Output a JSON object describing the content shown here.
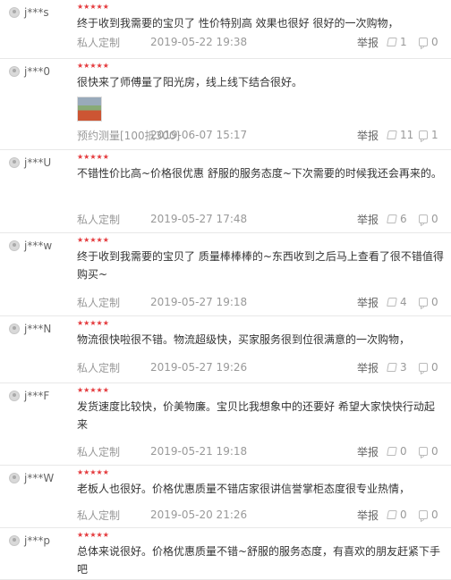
{
  "reviews": [
    {
      "user": "j***s",
      "stars": "★★★★★",
      "text": "终于收到我需要的宝贝了 性价特别高 效果也很好 很好的一次购物，",
      "has_image": false,
      "tag": "私人定制",
      "date": "2019-05-22 19:38",
      "report": "举报",
      "likes": "1",
      "replies": "0"
    },
    {
      "user": "j***0",
      "stars": "★★★★★",
      "text": "很快来了师傅量了阳光房，线上线下结合很好。",
      "has_image": true,
      "tag": "预约测量[100抵300]",
      "date": "2019-06-07 15:17",
      "report": "举报",
      "likes": "11",
      "replies": "1"
    },
    {
      "user": "j***U",
      "stars": "★★★★★",
      "text": "不错性价比高~价格很优惠 舒服的服务态度~下次需要的时候我还会再来的。",
      "has_image": false,
      "tag": "私人定制",
      "date": "2019-05-27 17:48",
      "report": "举报",
      "likes": "6",
      "replies": "0"
    },
    {
      "user": "j***w",
      "stars": "★★★★★",
      "text": "终于收到我需要的宝贝了 质量棒棒棒的~东西收到之后马上查看了很不错值得购买~",
      "has_image": false,
      "tag": "私人定制",
      "date": "2019-05-27 19:18",
      "report": "举报",
      "likes": "4",
      "replies": "0"
    },
    {
      "user": "j***N",
      "stars": "★★★★★",
      "text": "物流很快啦很不错。物流超级快，买家服务很到位很满意的一次购物，",
      "has_image": false,
      "tag": "私人定制",
      "date": "2019-05-27 19:26",
      "report": "举报",
      "likes": "3",
      "replies": "0"
    },
    {
      "user": "j***F",
      "stars": "★★★★★",
      "text": "发货速度比较快，价美物廉。宝贝比我想象中的还要好 希望大家快快行动起来",
      "has_image": false,
      "tag": "私人定制",
      "date": "2019-05-21 19:18",
      "report": "举报",
      "likes": "0",
      "replies": "0"
    },
    {
      "user": "j***W",
      "stars": "★★★★★",
      "text": "老板人也很好。价格优惠质量不错店家很讲信誉掌柜态度很专业热情，",
      "has_image": false,
      "tag": "私人定制",
      "date": "2019-05-20 21:26",
      "report": "举报",
      "likes": "0",
      "replies": "0"
    },
    {
      "user": "j***p",
      "stars": "★★★★★",
      "text": "总体来说很好。价格优惠质量不错~舒服的服务态度，有喜欢的朋友赶紧下手吧",
      "has_image": false,
      "tag": "",
      "date": "",
      "report": "",
      "likes": "",
      "replies": ""
    }
  ]
}
